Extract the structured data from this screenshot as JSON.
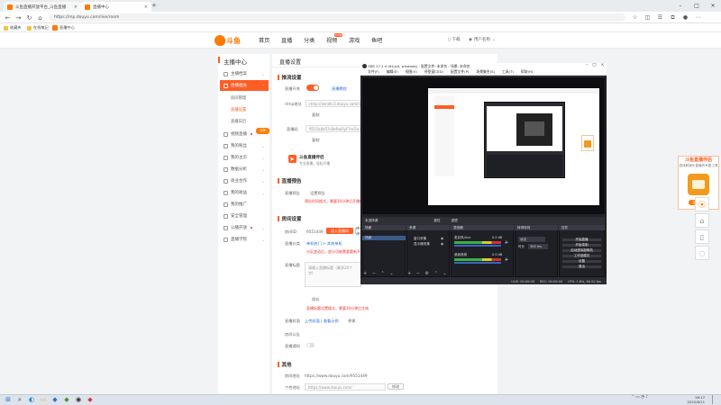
{
  "browser": {
    "tabs": [
      {
        "label": "斗鱼直播开放平台_斗鱼直播",
        "active": false
      },
      {
        "label": "直播中心",
        "active": true
      }
    ],
    "url": "https://mp.douyu.com/live/room",
    "bookmarks": [
      "收藏夹",
      "在线笔记",
      "直播中心"
    ]
  },
  "site": {
    "logo": "斗鱼",
    "nav": [
      "首页",
      "直播",
      "分类",
      "视频",
      "游戏",
      "鱼吧"
    ],
    "nav_badge": "new",
    "download": "下载",
    "user": "用户名称"
  },
  "sidebar": {
    "title": "主播中心",
    "items": [
      {
        "label": "主播档案"
      },
      {
        "label": "直播相关",
        "active": true
      },
      {
        "label": "视频直播"
      },
      {
        "label": "我的粉丝"
      },
      {
        "label": "我的主页"
      },
      {
        "label": "数据分析"
      },
      {
        "label": "商业合作"
      },
      {
        "label": "我的收益"
      },
      {
        "label": "我的推广"
      },
      {
        "label": "安全管理"
      },
      {
        "label": "公播开放"
      },
      {
        "label": "直播学院"
      }
    ],
    "subitems": [
      "房间管理",
      "直播设置",
      "直播日历"
    ],
    "promo_tag": "任务"
  },
  "main": {
    "title": "直播设置",
    "stream": {
      "section": "推流设置",
      "live_switch_label": "直播开关",
      "obs_link": "直播教程",
      "rtmp_label": "rtmp地址",
      "rtmp_value": "rtmp://sendtc3.douyu.com/live",
      "copy1": "复制",
      "code_label": "直播码",
      "code_value": "9551k8d5?c8eRwOyF?nc5e=",
      "copy2": "复制",
      "tool_title": "斗鱼直播伴侣",
      "tool_sub": "专业直播，轻松开播"
    },
    "notice": {
      "section": "直播预告",
      "label": "直播预告",
      "value": "设置预告",
      "warn": "预告时间格式，需要30分钟后开播的预告"
    },
    "room": {
      "section": "房间设置",
      "id_label": "房间ID",
      "id_value": "9551449",
      "enter_btn": "进入直播间",
      "change_btn": "修改",
      "cat_label": "直播分类",
      "cat_value": "单机热门 > 其他单机",
      "cat_warn": "分区变动后，部分功能需要重新开启",
      "title_label": "直播标题",
      "title_placeholder": "请输入直播标题（最多20个字）",
      "save": "保存",
      "title_warn": "直播标题设置格式，需要30分钟后生效",
      "cover_label": "直播封面",
      "cover_link": "上传封面 | 查看示例",
      "cover_btn": "更换",
      "notice_label": "房间公告",
      "switch_label": "直播通知"
    },
    "other": {
      "section": "其他",
      "link1_label": "房间地址",
      "link1_value": "https://www.douyu.com/9551449",
      "link2_label": "个性地址",
      "link2_value": "https://www.douyu.com/",
      "link2_btn": "修改"
    }
  },
  "promo": {
    "title": "斗鱼直播伴侣",
    "sub": "游戏和娱乐直播的专属工具",
    "btn": "立即下载"
  },
  "obs": {
    "title": "OBS 27.2.4 (64-bit, windows) - 配置文件: 未命名 - 场景: 未命名",
    "menu": [
      "文件(F)",
      "编辑(E)",
      "视图(V)",
      "停靠窗口(D)",
      "配置文件(P)",
      "场景集合(S)",
      "工具(T)",
      "帮助(H)"
    ],
    "source_bar": "未选择源",
    "properties": "属性",
    "filters": "滤镜",
    "panels": {
      "scenes": "场景",
      "sources": "来源",
      "mixer": "混音器",
      "transitions": "转场特效",
      "controls": "控件"
    },
    "scene_items": [
      "场景"
    ],
    "source_items": [
      "窗口采集",
      "显示器采集"
    ],
    "mixer_items": [
      {
        "name": "麦克风/Aux",
        "db": "0.0 dB"
      },
      {
        "name": "桌面音频",
        "db": "0.0 dB"
      }
    ],
    "transition": "淡出",
    "duration_label": "时长",
    "duration": "300 ms",
    "controls": [
      "开始直播",
      "开始录制",
      "启动虚拟摄像机",
      "工作室模式",
      "设置",
      "退出"
    ],
    "status": [
      "LIVE: 00:00:00",
      "REC: 00:00:00",
      "CPU: 1.6%, 60.00 fps"
    ]
  },
  "taskbar": {
    "time": "16:17",
    "date": "2022/8/11"
  }
}
